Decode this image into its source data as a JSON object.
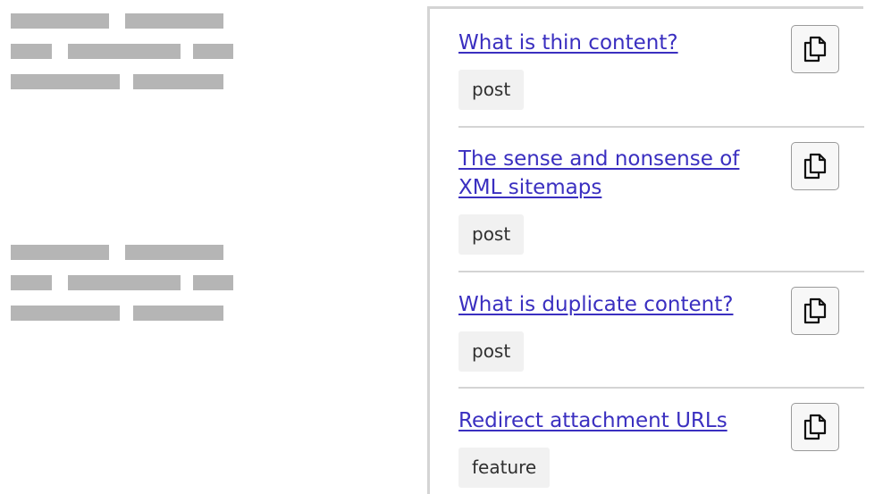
{
  "results": [
    {
      "title": "What is thin content?",
      "type": "post",
      "action_icon": "copy-icon"
    },
    {
      "title": "The sense and nonsense of XML sitemaps",
      "type": "post",
      "action_icon": "copy-icon"
    },
    {
      "title": "What is duplicate content?",
      "type": "post",
      "action_icon": "copy-icon"
    },
    {
      "title": "Redirect attachment URLs",
      "type": "feature",
      "action_icon": "copy-icon"
    }
  ],
  "colors": {
    "link": "#3a2fc0",
    "skeleton": "#b5b5b5",
    "tag_bg": "#f1f1f1",
    "divider": "#d4d4d4"
  }
}
